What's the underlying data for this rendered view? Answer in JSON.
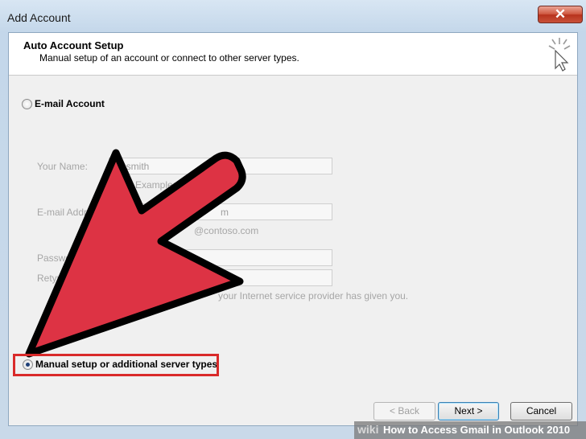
{
  "window": {
    "title": "Add Account",
    "close_glyph": "✕"
  },
  "header": {
    "title": "Auto Account Setup",
    "subtitle": "Manual setup of an account or connect to other server types.",
    "icon": "wand-icon"
  },
  "email_option": {
    "label": "E-mail Account",
    "selected": false
  },
  "form": {
    "your_name_label": "Your Name:",
    "your_name_value": "ne smith",
    "your_name_hint": "Example: E",
    "email_label": "E-mail Addr",
    "email_value": "m",
    "email_hint": "@contoso.com",
    "password_label": "Passwo",
    "retype_label": "Retyp",
    "password_hint": "your Internet service provider has given you."
  },
  "manual_option": {
    "label": "Manual setup or additional server types",
    "selected": true
  },
  "buttons": {
    "back": "< Back",
    "next": "Next >",
    "cancel": "Cancel"
  },
  "colors": {
    "arrow": "#dd3344",
    "highlight": "#d92a2a"
  },
  "banner": {
    "wiki": "wiki",
    "text": "How to Access Gmail in Outlook 2010"
  }
}
